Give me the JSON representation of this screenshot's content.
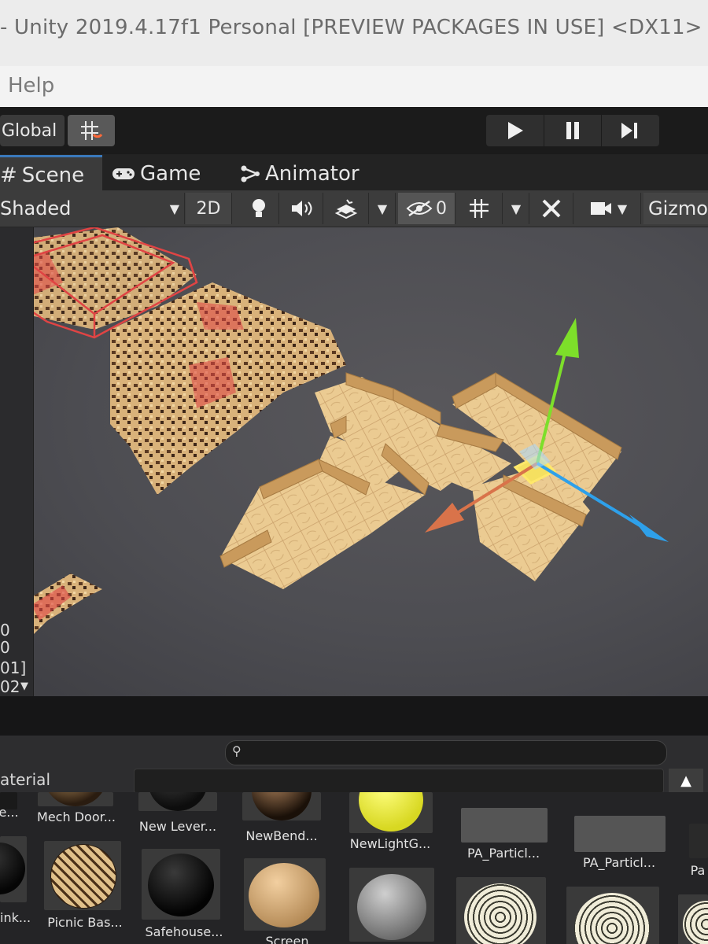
{
  "window": {
    "title": "- Unity 2019.4.17f1 Personal [PREVIEW PACKAGES IN USE] <DX11>"
  },
  "menu": {
    "items": [
      "Help"
    ]
  },
  "toolbar": {
    "pivot_space_label": "Global",
    "snap_icon": "grid-snap-icon",
    "play_icon": "play-icon",
    "pause_icon": "pause-icon",
    "step_icon": "step-icon"
  },
  "tabs": [
    {
      "label": "Scene",
      "icon": "hash-icon",
      "active": true
    },
    {
      "label": "Game",
      "icon": "gamepad-icon",
      "active": false
    },
    {
      "label": "Animator",
      "icon": "animator-icon",
      "active": false
    }
  ],
  "scene_toolbar": {
    "shading_mode": "Shaded",
    "mode_2d_label": "2D",
    "hidden_count": "0",
    "gizmos_label": "Gizmo"
  },
  "left_strip": {
    "lines": [
      "0",
      "0",
      "01]",
      "02"
    ]
  },
  "project": {
    "search_placeholder": "",
    "filter_label": "aterial"
  },
  "assets": {
    "row1": [
      "e...",
      "Mech Door...",
      "New Lever...",
      "NewBend...",
      "NewLightG...",
      "PA_Particl...",
      "PA_Particl...",
      "Pa"
    ],
    "row2": [
      "ink...",
      "Picnic Bas...",
      "Safehouse...",
      "Screen"
    ]
  },
  "colors": {
    "accent_blue": "#3a79bb",
    "gizmo_y": "#7ddf2a",
    "gizmo_x": "#d9734a",
    "gizmo_z": "#2ea0ea",
    "floor": "#e8c58a",
    "selection_red": "#e04444"
  }
}
